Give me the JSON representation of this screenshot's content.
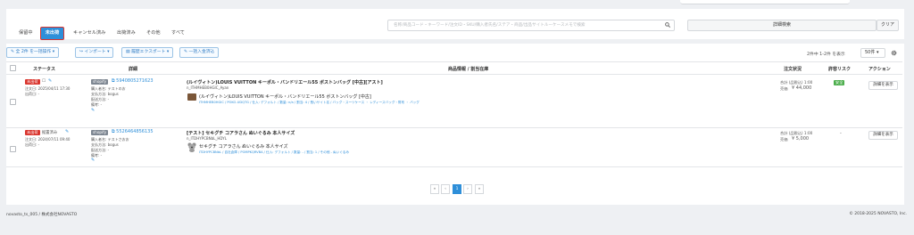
{
  "tabs": [
    {
      "label": "保留中"
    },
    {
      "label": "未出荷"
    },
    {
      "label": "キャンセル済み"
    },
    {
      "label": "出荷済み"
    },
    {
      "label": "その他"
    },
    {
      "label": "すべて"
    }
  ],
  "search": {
    "placeholder": "名称/商品コード・キーワード/注文ID・SKU/購入者氏名/ステア・商品/出品サイトルーケースメモで検索",
    "advanced_label": "詳細検索",
    "clear_label": "クリア"
  },
  "toolbar": {
    "bulk_label": "全 2件 を一括操作",
    "import_label": "インポート",
    "export_label": "履歴エクスポート",
    "bulk_register_label": "一括入金済込"
  },
  "pagination_info": {
    "count_text": "2件中 1-2件 を表示",
    "per_page": "50件"
  },
  "table": {
    "headers": {
      "status": "ステータス",
      "detail": "詳細",
      "product": "商品情報 / 割当在庫",
      "order_status": "注文状況",
      "permit_risk": "許容リスク",
      "action": "アクション"
    }
  },
  "rows": [
    {
      "status_badge": "未出荷",
      "status_extra": "",
      "order_date": "注文日: 2025/04/11 17:30",
      "ship_date": "出荷日: -",
      "shop_badge": "shopify",
      "order_id": "5940805271623",
      "buyer": "購入者名: テストのお",
      "payment": "支払方法: bogus",
      "shipping": "配送方法: -",
      "note": "備考: -",
      "title": "(ルイヴィトン)LOUIS VUITTON キーポル・バンドリエール55 ボストンバッグ [中古][アスト]",
      "sku": "n_ITHMHEB0HGIC_Ayan",
      "alloc_title": "(ルイヴィトン)LOUIS VUITTON キーポル・バンドリエール55 ボストンバッグ [中古]",
      "alloc_meta": "ITHMHEB0HGIC / POKO-UDQTG / 仕入: デフォルト / 数量: n/a / 割当: 4 / 長いサイト名 / バッグ・スーツケース ・ レディースバッグ・財布 ・ バッグ",
      "price_line": "合計 (品税込) 1:00",
      "price_sub": "売価",
      "price": "¥ 44,000",
      "risk_badge": "安全",
      "risk_dash": "",
      "action_label": "詳細を表示"
    },
    {
      "status_badge": "未出荷",
      "status_extra": "据置済み",
      "order_date": "注文日: 2024/07/11 09:40",
      "ship_date": "出荷日: -",
      "shop_badge": "shopify",
      "order_id": "5526464856135",
      "buyer": "購入者名: テストさおお",
      "payment": "支払方法: bogus",
      "shipping": "配送方法: -",
      "note": "備考: -",
      "title": "[テスト] セキグチ コアラさん ぬいぐるみ 本人サイズ",
      "sku": "n_ITDHYPCBNbL_HDYL",
      "alloc_title": "セキグチ コアラさん ぬいぐるみ 本人サイズ",
      "alloc_meta": "ITDHYPCBNbL / 自社倉庫 / POMPKQRVBA / 仕入: デフォルト / 数量: - / 割当: 1 / その他 - ぬいぐるみ",
      "price_line": "合計 (品税込) 1:00",
      "price_sub": "売価",
      "price": "¥ 5,000",
      "risk_badge": "",
      "risk_dash": "-",
      "action_label": "詳細を表示"
    }
  ],
  "pagination": {
    "first": "«",
    "prev": "‹",
    "current": "1",
    "next": "›",
    "last": "»"
  },
  "footer": {
    "left": "novasto_ts_005 / 株式会社NOVASTO",
    "right": "© 2018-2025 NOVASTO, Inc."
  },
  "colors": {
    "accent": "#2e8fd9",
    "danger": "#d9352e",
    "success": "#4cae4c",
    "link": "#2e8fd9"
  },
  "icons": {
    "gear": "gear-icon",
    "pencil": "pencil-icon",
    "external": "external-link-icon",
    "bag": "bag-thumbnail",
    "koala": "koala-thumbnail"
  }
}
